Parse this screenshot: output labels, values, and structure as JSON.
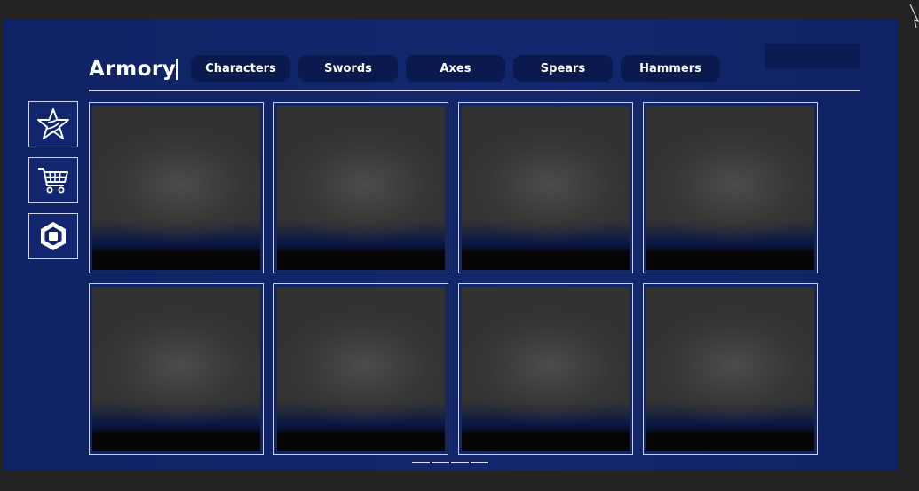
{
  "header": {
    "title": "Armory"
  },
  "tabs": [
    {
      "label": "Characters"
    },
    {
      "label": "Swords"
    },
    {
      "label": "Axes"
    },
    {
      "label": "Spears"
    },
    {
      "label": "Hammers"
    }
  ],
  "sidebar": {
    "items": [
      {
        "icon": "star-icon"
      },
      {
        "icon": "cart-icon"
      },
      {
        "icon": "robux-icon"
      }
    ]
  },
  "grid": {
    "rows": 2,
    "columns": 4,
    "items": [
      {},
      {},
      {},
      {},
      {},
      {},
      {},
      {}
    ]
  },
  "pagination": {
    "pages": 4
  },
  "colors": {
    "background": "#232323",
    "panel": "#12276e",
    "tab": "#0a1a4e",
    "border": "#cfd3ec",
    "text": "#ffffff"
  }
}
